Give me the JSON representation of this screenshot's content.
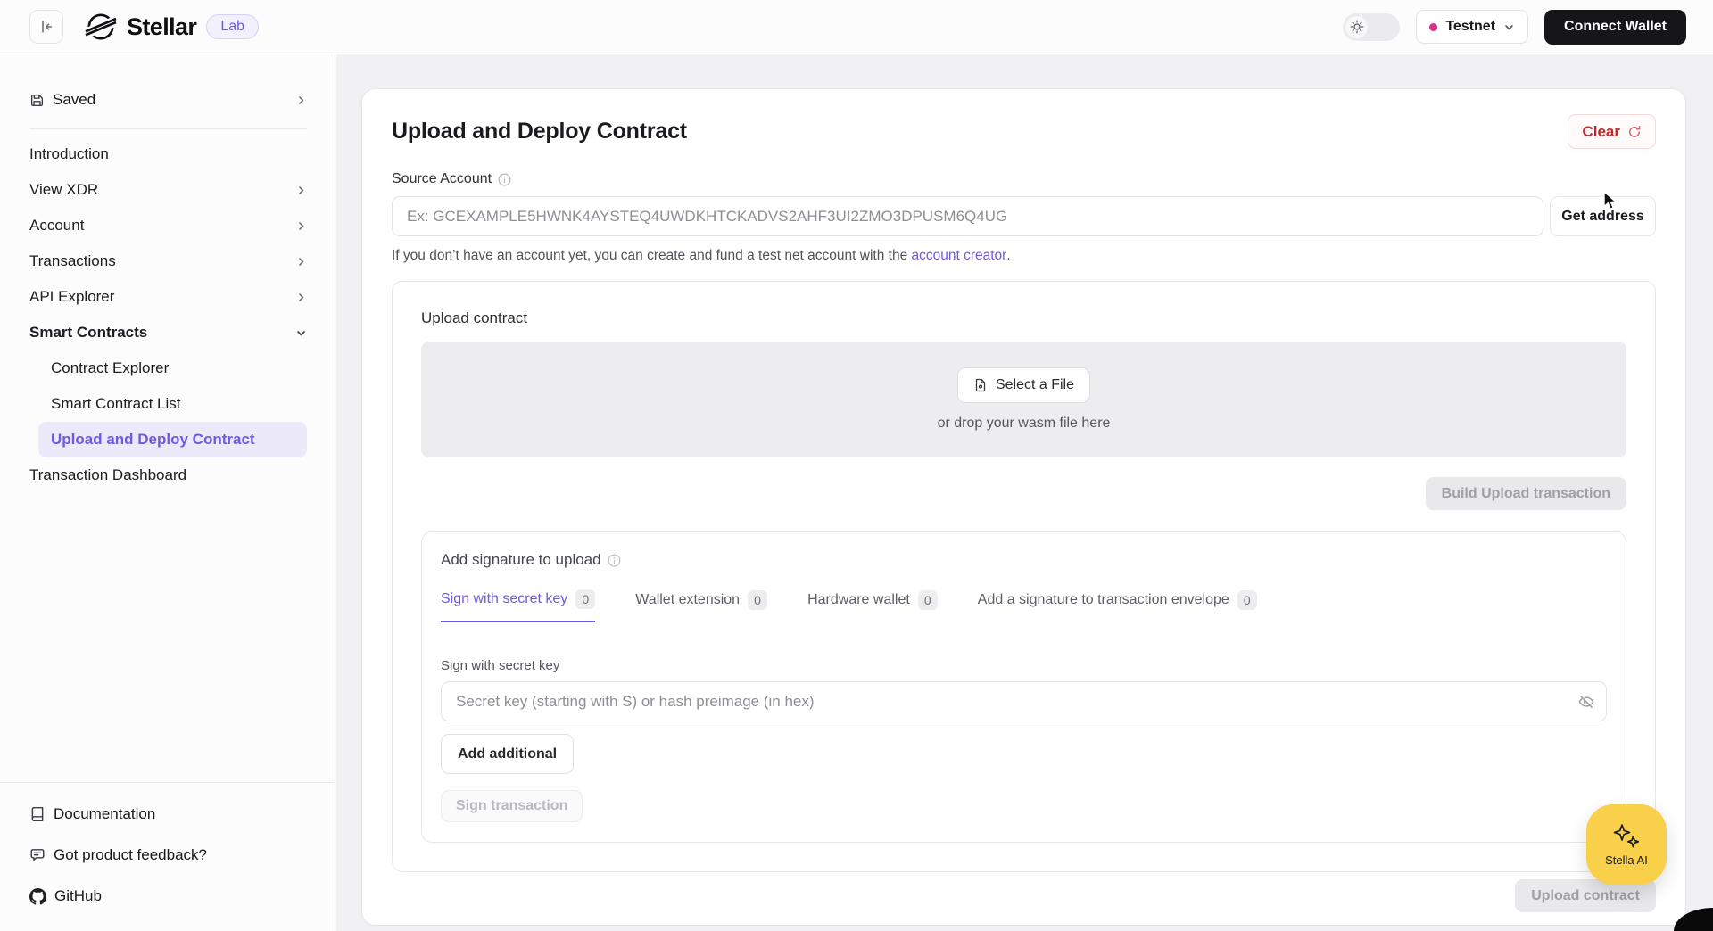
{
  "header": {
    "brand": "Stellar",
    "badge": "Lab",
    "network_label": "Testnet",
    "connect_wallet": "Connect Wallet"
  },
  "sidebar": {
    "saved_label": "Saved",
    "items": [
      {
        "label": "Introduction"
      },
      {
        "label": "View XDR"
      },
      {
        "label": "Account"
      },
      {
        "label": "Transactions"
      },
      {
        "label": "API Explorer"
      },
      {
        "label": "Smart Contracts"
      },
      {
        "label": "Contract Explorer"
      },
      {
        "label": "Smart Contract List"
      },
      {
        "label": "Upload and Deploy Contract",
        "active": true
      },
      {
        "label": "Transaction Dashboard"
      }
    ],
    "footer": [
      {
        "label": "Documentation"
      },
      {
        "label": "Got product feedback?"
      },
      {
        "label": "GitHub"
      }
    ]
  },
  "main": {
    "title": "Upload and Deploy Contract",
    "clear_label": "Clear",
    "source_account": {
      "label": "Source Account",
      "placeholder": "Ex: GCEXAMPLE5HWNK4AYSTEQ4UWDKHTCKADVS2AHF3UI2ZMO3DPUSM6Q4UG",
      "get_address_label": "Get address",
      "helper_prefix": "If you don’t have an account yet, you can create and fund a test net account with the ",
      "helper_link": "account creator",
      "helper_suffix": "."
    },
    "upload": {
      "label": "Upload contract",
      "select_file_label": "Select a File",
      "drop_hint": "or drop your wasm file here",
      "build_button_label": "Build Upload transaction"
    },
    "signature": {
      "title": "Add signature to upload",
      "tabs": [
        {
          "label": "Sign with secret key",
          "count": "0",
          "active": true
        },
        {
          "label": "Wallet extension",
          "count": "0"
        },
        {
          "label": "Hardware wallet",
          "count": "0"
        },
        {
          "label": "Add a signature to transaction envelope",
          "count": "0"
        }
      ],
      "secret_key": {
        "label": "Sign with secret key",
        "placeholder": "Secret key (starting with S) or hash preimage (in hex)"
      },
      "add_additional_label": "Add additional",
      "sign_transaction_label": "Sign transaction"
    },
    "upload_contract_label": "Upload contract"
  },
  "stella": {
    "label": "Stella AI"
  },
  "colors": {
    "accent_purple": "#6c5be0",
    "accent_purple_bg": "#ece9fb",
    "danger_red": "#c1272d",
    "testnet_dot_pink": "#d6338a",
    "stella_yellow": "#f8d04a",
    "dark_button": "#161618"
  }
}
